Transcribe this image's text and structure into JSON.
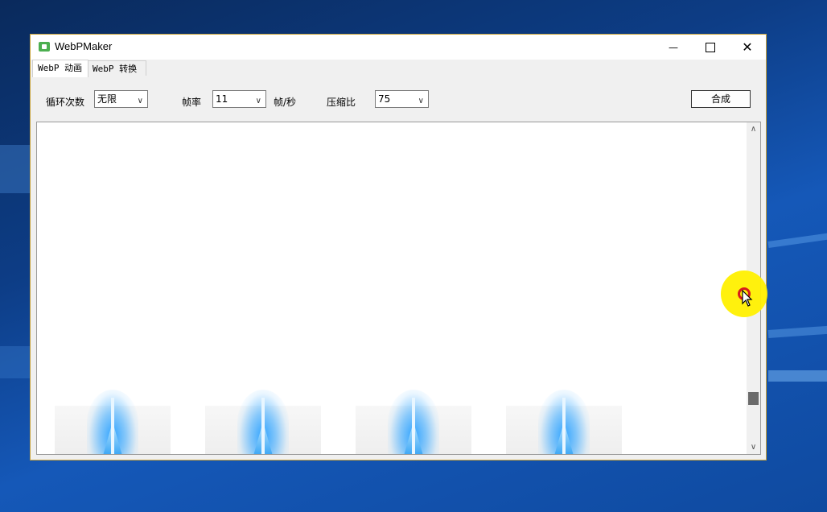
{
  "window": {
    "title": "WebPMaker",
    "controls": {
      "minimize": "—",
      "maximize": "□",
      "close": "✕"
    }
  },
  "tabs": [
    {
      "label": "WebP 动画",
      "active": true
    },
    {
      "label": "WebP 转换",
      "active": false
    }
  ],
  "toolbar": {
    "loop_label": "循环次数",
    "loop_value": "无限",
    "framerate_label": "帧率",
    "framerate_value": "11",
    "framerate_unit": "帧/秒",
    "compression_label": "压缩比",
    "compression_value": "75",
    "compose_button": "合成"
  },
  "preview": {
    "thumbnail_count": 4,
    "scroll_position_fraction": 0.83
  },
  "colors": {
    "accent_border": "#c9a33a",
    "cursor_highlight": "#ffef00",
    "cursor_dot": "#d81b1b"
  },
  "icons": {
    "chevron": "chevron-down-icon",
    "scroll_up": "chevron-up-icon",
    "scroll_down": "chevron-down-icon"
  }
}
